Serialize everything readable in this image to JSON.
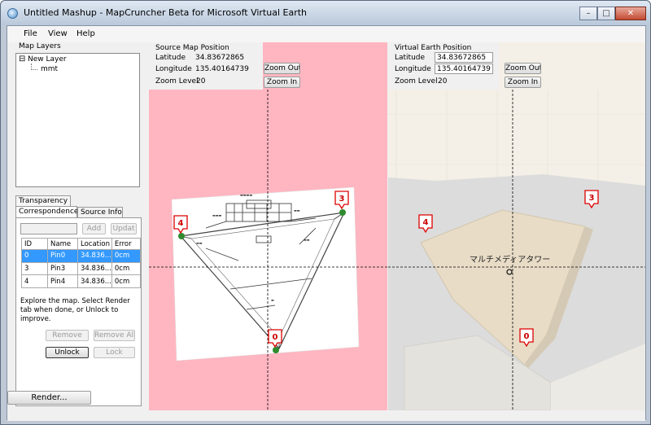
{
  "window": {
    "title": "Untitled Mashup - MapCruncher Beta for Microsoft Virtual Earth",
    "minimize": "–",
    "maximize": "□",
    "close": "✕"
  },
  "menu": [
    "File",
    "View",
    "Help"
  ],
  "map_layers": {
    "heading": "Map Layers",
    "layer": "New Layer",
    "item": "mmt",
    "expander": "⊟"
  },
  "tabs": {
    "transparency": "Transparency",
    "correspondences": "Correspondences",
    "source_info": "Source Info"
  },
  "correspondence": {
    "name_value": "",
    "add_label": "Add",
    "update_label": "Updat",
    "columns": [
      "ID",
      "Name",
      "Location",
      "Error"
    ],
    "rows": [
      {
        "id": "0",
        "name": "Pin0",
        "location": "34.836...",
        "error": "0cm",
        "selected": true
      },
      {
        "id": "3",
        "name": "Pin3",
        "location": "34.836...",
        "error": "0cm",
        "selected": false
      },
      {
        "id": "4",
        "name": "Pin4",
        "location": "34.836...",
        "error": "0cm",
        "selected": false
      }
    ],
    "help": "Explore the map. Select Render tab when done, or Unlock to improve.",
    "remove_label": "Remove",
    "remove_all_label": "Remove All",
    "unlock_label": "Unlock",
    "lock_label": "Lock"
  },
  "render_label": "Render...",
  "source_map": {
    "title": "Source Map Position",
    "lat_label": "Latitude",
    "lat_value": "34.83672865",
    "lon_label": "Longitude",
    "lon_value": "135.40164739",
    "zoom_label": "Zoom Level",
    "zoom_value": "20",
    "zoom_out": "Zoom Out",
    "zoom_in": "Zoom In"
  },
  "virtual_earth": {
    "title": "Virtual Earth Position",
    "lat_label": "Latitude",
    "lat_value": "34.83672865",
    "lon_label": "Longitude",
    "lon_value": "135.40164739",
    "zoom_label": "Zoom Level",
    "zoom_value": "20",
    "zoom_out": "Zoom Out",
    "zoom_in": "Zoom In",
    "map_label": "マルチメディアタワー"
  },
  "pins": {
    "source": [
      "4",
      "3",
      "0"
    ],
    "virtual": [
      "4",
      "3",
      "0"
    ]
  },
  "colors": {
    "source_bg": "#ffb6c1",
    "earth_bg": "#f4f0e7",
    "building": "#e8dcc7",
    "road": "#e0e0e0",
    "pin_fill": "#ffffff",
    "pin_border": "#d00000",
    "pin_dot": "#2e8b2e",
    "crosshair": "#000000"
  }
}
